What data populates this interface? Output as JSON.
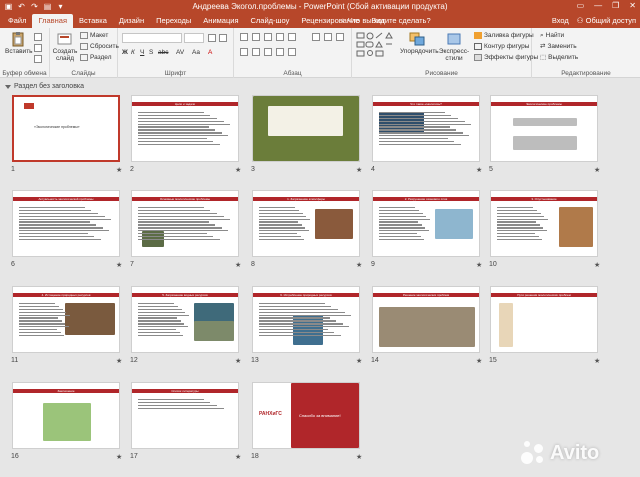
{
  "window": {
    "title": "Андреева Экогол.проблемы - PowerPoint (Сбой активации продукта)",
    "controls": {
      "minimize": "—",
      "restore": "❐",
      "close": "✕"
    }
  },
  "tabs": [
    {
      "label": "Файл"
    },
    {
      "label": "Главная"
    },
    {
      "label": "Вставка"
    },
    {
      "label": "Дизайн"
    },
    {
      "label": "Переходы"
    },
    {
      "label": "Анимация"
    },
    {
      "label": "Слайд-шоу"
    },
    {
      "label": "Рецензирование"
    },
    {
      "label": "Вид"
    }
  ],
  "tell_me": "♀ Что вы хотите сделать?",
  "user": {
    "sign_in": "Вход",
    "share": "Общий доступ"
  },
  "ribbon": {
    "clipboard": {
      "paste": "Вставить",
      "label": "Буфер обмена"
    },
    "slides": {
      "new_slide": "Создать слайд",
      "layout": "Макет",
      "reset": "Сбросить",
      "section": "Раздел",
      "label": "Слайды"
    },
    "font": {
      "label": "Шрифт"
    },
    "paragraph": {
      "label": "Абзац"
    },
    "drawing": {
      "arrange": "Упорядочить",
      "quick_styles": "Экспресс-стили",
      "fill": "Заливка фигуры",
      "outline": "Контур фигуры",
      "effects": "Эффекты фигуры",
      "label": "Рисование"
    },
    "editing": {
      "find": "Найти",
      "replace": "Заменить",
      "select": "Выделить",
      "label": "Редактирование"
    }
  },
  "section_header": "Раздел без заголовка",
  "slides": [
    {
      "num": "1",
      "selected": true,
      "title": "«Экологические проблемы»"
    },
    {
      "num": "2",
      "title": "Цели и задачи"
    },
    {
      "num": "3",
      "title": ""
    },
    {
      "num": "4",
      "title": "Что такое «экология»?"
    },
    {
      "num": "5",
      "title": "Экологические проблемы"
    },
    {
      "num": "6",
      "title": "Актуальность экологической проблемы"
    },
    {
      "num": "7",
      "title": "Основные экологические проблемы"
    },
    {
      "num": "8",
      "title": "1. Загрязнение атмосферы"
    },
    {
      "num": "9",
      "title": "2. Разрушение озонового слоя"
    },
    {
      "num": "10",
      "title": "3. Опустынивание"
    },
    {
      "num": "11",
      "title": "4. Истощение природных ресурсов"
    },
    {
      "num": "12",
      "title": "5. Загрязнение водных ресурсов"
    },
    {
      "num": "13",
      "title": "6. Истребление природных ресурсов"
    },
    {
      "num": "14",
      "title": "Решение экологических проблем"
    },
    {
      "num": "15",
      "title": "Пути решения экологических проблем"
    },
    {
      "num": "16",
      "title": "Заключение"
    },
    {
      "num": "17",
      "title": "Список литературы"
    },
    {
      "num": "18",
      "title": "Спасибо за внимание!"
    }
  ],
  "slide18_logo": "РАНХиГС",
  "watermark": "Avito"
}
